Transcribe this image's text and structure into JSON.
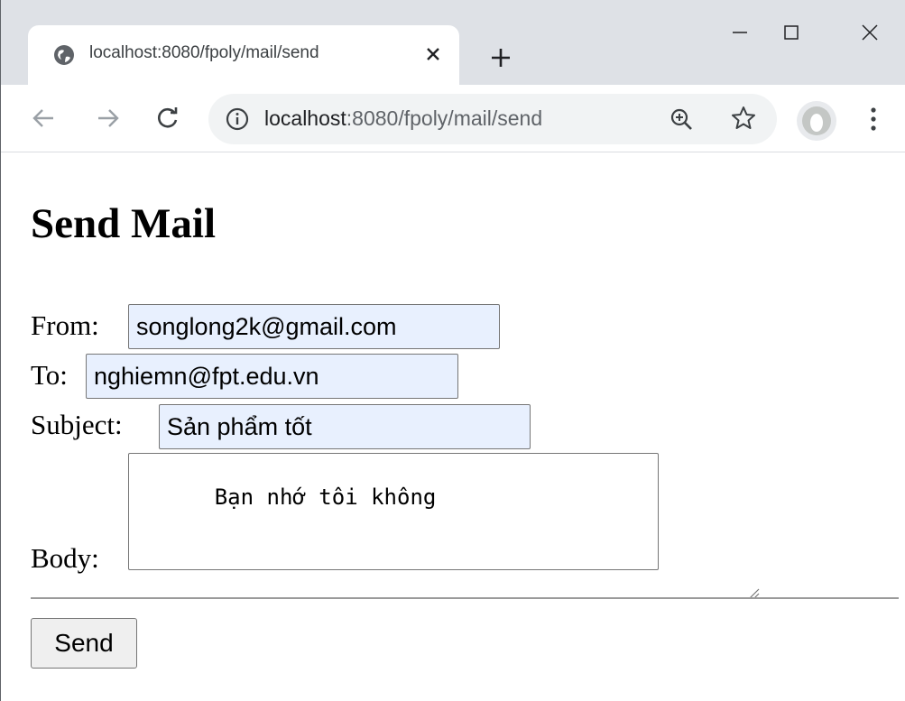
{
  "browser": {
    "tab_title": "localhost:8080/fpoly/mail/send",
    "url_host": "localhost",
    "url_rest": ":8080/fpoly/mail/send",
    "icons": [
      "globe-icon",
      "close-icon",
      "plus-icon",
      "minimize-icon",
      "maximize-icon",
      "window-close-icon",
      "back-arrow-icon",
      "forward-arrow-icon",
      "reload-icon",
      "info-icon",
      "zoom-icon",
      "star-icon",
      "profile-icon",
      "kebab-menu-icon"
    ]
  },
  "page": {
    "heading": "Send Mail",
    "from_label": "From:",
    "from_value": "songlong2k@gmail.com",
    "to_label": "To:",
    "to_value": "nghiemn@fpt.edu.vn",
    "subject_label": "Subject:",
    "subject_value": "Sản phẩm tốt",
    "body_label": "Body:",
    "body_value": "Bạn nhớ tôi không",
    "send_label": "Send"
  },
  "colors": {
    "tabstrip": "#dee1e6",
    "omnibox": "#f1f3f4",
    "autofill": "#e8f0fe"
  }
}
